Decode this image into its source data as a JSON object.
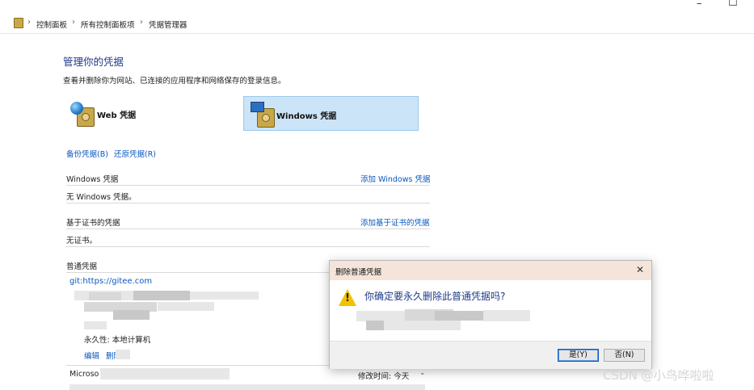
{
  "window": {
    "minimize": "–",
    "maximize": "☐"
  },
  "breadcrumb": {
    "item1": "控制面板",
    "item2": "所有控制面板项",
    "item3": "凭据管理器",
    "sep": "›"
  },
  "page": {
    "title": "管理你的凭据",
    "description": "查看并删除你为网站、已连接的应用程序和网络保存的登录信息。"
  },
  "tiles": {
    "web": "Web 凭据",
    "windows": "Windows 凭据"
  },
  "actions": {
    "backup": "备份凭据(B)",
    "restore": "还原凭据(R)"
  },
  "sections": {
    "windows": {
      "title": "Windows 凭据",
      "add": "添加 Windows 凭据",
      "empty": "无 Windows 凭据。"
    },
    "cert": {
      "title": "基于证书的凭据",
      "add": "添加基于证书的凭据",
      "empty": "无证书。"
    },
    "generic": {
      "title": "普通凭据",
      "item1": {
        "name": "git:https://gitee.com",
        "persistence": "永久性: 本地计算机",
        "edit": "编辑",
        "delete": "删除"
      },
      "item2": {
        "name_prefix": "Microso",
        "modified": "修改时间: 今天"
      }
    }
  },
  "dialog": {
    "title": "删除普通凭据",
    "question": "你确定要永久删除此普通凭据吗?",
    "yes": "是(Y)",
    "no": "否(N)"
  },
  "watermark": "CSDN @小鸟哗啦啦",
  "icons": [
    "folder-icon",
    "globe-icon",
    "safe-icon",
    "monitor-icon",
    "warning-icon",
    "close-icon",
    "chevron-down-icon"
  ]
}
